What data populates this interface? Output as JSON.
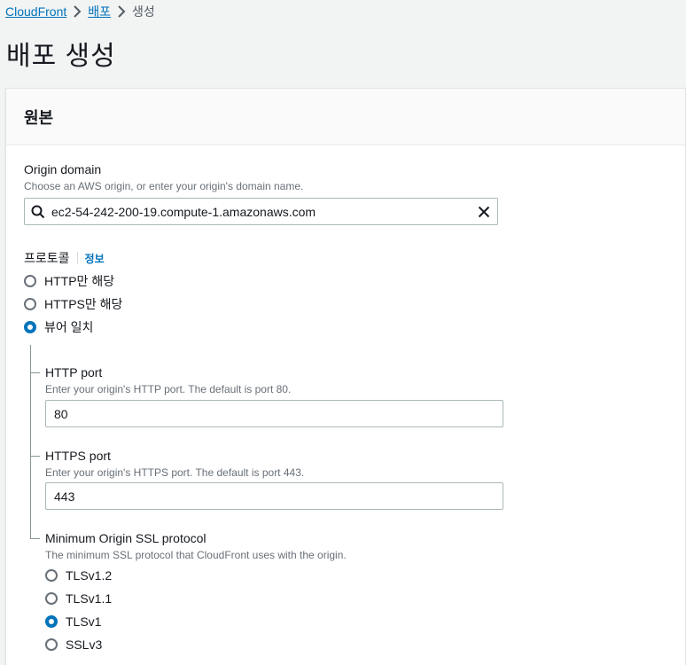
{
  "breadcrumb": {
    "items": [
      {
        "label": "CloudFront"
      },
      {
        "label": "배포"
      },
      {
        "label": "생성"
      }
    ]
  },
  "page": {
    "title": "배포 생성"
  },
  "panel": {
    "title": "원본"
  },
  "origin_domain": {
    "label": "Origin domain",
    "description": "Choose an AWS origin, or enter your origin's domain name.",
    "value": "ec2-54-242-200-19.compute-1.amazonaws.com"
  },
  "protocol": {
    "label": "프로토콜",
    "info": "정보",
    "options": [
      {
        "label": "HTTP만 해당",
        "selected": false
      },
      {
        "label": "HTTPS만 해당",
        "selected": false
      },
      {
        "label": "뷰어 일치",
        "selected": true
      }
    ]
  },
  "http_port": {
    "label": "HTTP port",
    "description": "Enter your origin's HTTP port. The default is port 80.",
    "value": "80"
  },
  "https_port": {
    "label": "HTTPS port",
    "description": "Enter your origin's HTTPS port. The default is port 443.",
    "value": "443"
  },
  "ssl_protocol": {
    "label": "Minimum Origin SSL protocol",
    "description": "The minimum SSL protocol that CloudFront uses with the origin.",
    "options": [
      {
        "label": "TLSv1.2",
        "selected": false
      },
      {
        "label": "TLSv1.1",
        "selected": false
      },
      {
        "label": "TLSv1",
        "selected": true
      },
      {
        "label": "SSLv3",
        "selected": false
      }
    ]
  },
  "colors": {
    "accent": "#0073bb",
    "page_bg": "#f2f3f3"
  },
  "icons": {
    "search": "search-icon",
    "clear": "close-icon",
    "separator": "chevron-right-icon"
  }
}
